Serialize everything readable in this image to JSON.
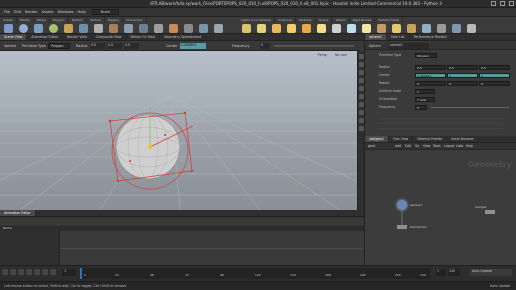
{
  "window": {
    "title": "/RTLAB/work/tufa.sy/work_Files/PORTSPOPS_020_010_h.x8/POPS_020_010_h.x8_001.hipic - Houdini Indie Limited-Commercial 19.0.383 - Python 3"
  },
  "menu": {
    "items": [
      "File",
      "Edit",
      "Render",
      "Assets",
      "Windows",
      "Help"
    ],
    "desktop": "Build"
  },
  "shelf_tabs": [
    "Create",
    "Modify",
    "Model",
    "Polygon",
    "Deform",
    "Texture",
    "Rigging",
    "Characters"
  ],
  "shelf_tabs_right": [
    "Lights and Cameras",
    "Collisions",
    "Particles",
    "Grains",
    "Vellum",
    "Rigid Bodies",
    "Particle Fluids"
  ],
  "scene_tabs": [
    "Scene View",
    "Animation Editor",
    "Render View",
    "Composite View",
    "Motion FX View",
    "Geometry Spreadsheet"
  ],
  "tool_options": {
    "sphere_label": "Sphere",
    "primitive_type_label": "Primitive Type",
    "primitive_type_value": "Polygon",
    "radius_label": "Radius",
    "radius_values": [
      "0.5",
      "0.5",
      "0.5"
    ],
    "center_label": "Center",
    "center_value": "0.269803",
    "frequency_label": "Frequency",
    "frequency_value": "5"
  },
  "viewport": {
    "persp_label": "Persp",
    "cam_label": "No cam",
    "path": "geo1"
  },
  "right_tabs": [
    "sphere1",
    "Take List",
    "Performance Monitor"
  ],
  "node_header": {
    "type_label": "Sphere",
    "name": "sphere1"
  },
  "params": [
    {
      "label": "Primitive Type",
      "values": [
        "Polygon"
      ]
    },
    {
      "label": "Radius",
      "values": [
        "0.5",
        "0.5",
        "0.5"
      ]
    },
    {
      "label": "Center",
      "values": [
        "0.269803",
        "0",
        "0"
      ]
    },
    {
      "label": "Rotate",
      "values": [
        "0",
        "0",
        "0"
      ]
    },
    {
      "label": "Uniform Scale",
      "values": [
        "1"
      ]
    },
    {
      "label": "Orientation",
      "values": [
        "Y Axis"
      ]
    },
    {
      "label": "Frequency",
      "values": [
        "5"
      ]
    }
  ],
  "network_tabs": [
    "/obj/geo1",
    "Tree View",
    "Material Palette",
    "Asset Browser"
  ],
  "network": {
    "path": "geo1",
    "menu": [
      "Add",
      "Edit",
      "Go",
      "View",
      "Tools",
      "Layout",
      "Labs",
      "Help"
    ],
    "watermark": "Geometry",
    "nodes": [
      {
        "name": "sphere1",
        "color": "#6a86b6"
      },
      {
        "name": "transform1",
        "color": "#8f8f8f"
      },
      {
        "name": "merge1",
        "color": "#8f8f8f"
      }
    ]
  },
  "timeline": {
    "header": "Animation Editor",
    "channel_label": "Name",
    "frames": [
      "1",
      "24",
      "48",
      "72",
      "96",
      "120",
      "144",
      "168",
      "192",
      "216",
      "240"
    ],
    "current_frame": "1",
    "start": "1",
    "end": "240",
    "sync": "Auto Update"
  },
  "status": {
    "text": "Left mouse button to select, Shift to add, Ctrl to toggle, Ctrl+Shift to remove",
    "update_mode": "Auto Update"
  },
  "colors": {
    "accent": "#5a9aa5",
    "handles": "#e0342c",
    "selection": "#f2c300",
    "node_sphere": "#6a86b6"
  }
}
